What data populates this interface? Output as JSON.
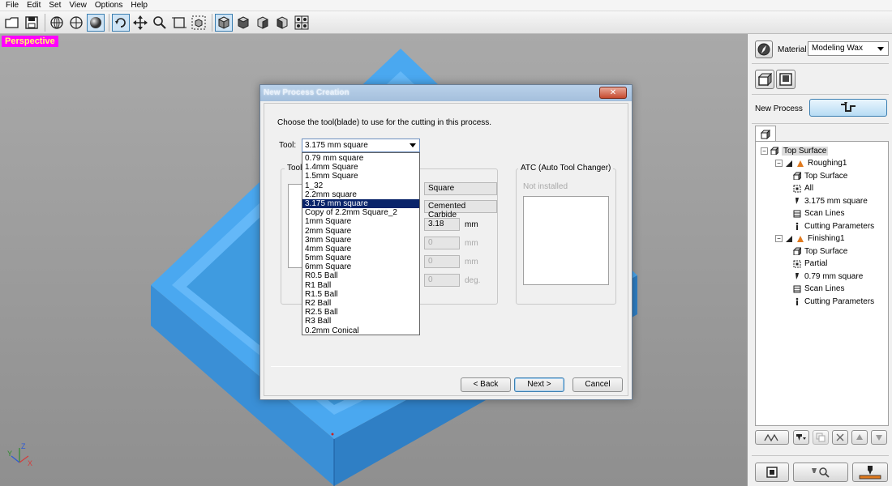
{
  "menu": [
    "File",
    "Edit",
    "Set",
    "View",
    "Options",
    "Help"
  ],
  "viewport": {
    "label": "Perspective",
    "axis_labels": {
      "x": "X",
      "y": "Y",
      "z": "Z"
    }
  },
  "dialog": {
    "title": "New Process Creation",
    "close_label": "✕",
    "prompt": "Choose the tool(blade) to use for the cutting in this process.",
    "tool_label": "Tool:",
    "tool_selected": "3.175 mm square",
    "tool_options": [
      "0.79 mm square",
      "1.4mm Square",
      "1.5mm Square",
      "1_32",
      "2.2mm square",
      "3.175 mm square",
      "Copy of 2.2mm Square_2",
      "1mm Square",
      "2mm Square",
      "3mm Square",
      "4mm Square",
      "5mm Square",
      "6mm Square",
      "R0.5 Ball",
      "R1 Ball",
      "R1.5 Ball",
      "R2 Ball",
      "R2.5 Ball",
      "R3 Ball",
      "0.2mm Conical"
    ],
    "tool_group_title": "Tool",
    "fields": {
      "shape": "Square",
      "material": "Cemented Carbide",
      "diameter": "3.18",
      "diameter_unit": "mm",
      "f2": "0",
      "f2_unit": "mm",
      "f3": "0",
      "f3_unit": "mm",
      "f4": "0",
      "f4_unit": "deg."
    },
    "atc_title": "ATC (Auto Tool Changer)",
    "atc_status": "Not installed",
    "back_label": "< Back",
    "next_label": "Next >",
    "cancel_label": "Cancel"
  },
  "panel": {
    "material_label": "Material",
    "material_value": "Modeling Wax",
    "new_process_label": "New Process",
    "tree": [
      {
        "label": "Top Surface",
        "level": 0,
        "icon": "surface-icon",
        "toggle": "−",
        "selected": true
      },
      {
        "label": "Roughing1",
        "level": 1,
        "icon": "roughing-icon",
        "toggle": "−"
      },
      {
        "label": "Top Surface",
        "level": 2,
        "icon": "surface-icon"
      },
      {
        "label": "All",
        "level": 2,
        "icon": "area-icon"
      },
      {
        "label": "3.175 mm square",
        "level": 2,
        "icon": "tool-icon"
      },
      {
        "label": "Scan Lines",
        "level": 2,
        "icon": "scanlines-icon"
      },
      {
        "label": "Cutting Parameters",
        "level": 2,
        "icon": "parameters-icon"
      },
      {
        "label": "Finishing1",
        "level": 1,
        "icon": "finishing-icon",
        "toggle": "−"
      },
      {
        "label": "Top Surface",
        "level": 2,
        "icon": "surface-icon"
      },
      {
        "label": "Partial",
        "level": 2,
        "icon": "area-icon"
      },
      {
        "label": "0.79 mm square",
        "level": 2,
        "icon": "tool-icon"
      },
      {
        "label": "Scan Lines",
        "level": 2,
        "icon": "scanlines-icon"
      },
      {
        "label": "Cutting Parameters",
        "level": 2,
        "icon": "parameters-icon"
      }
    ]
  },
  "colors": {
    "model_blue": "#4aa8f0",
    "perspective_bg": "#ff00ff",
    "selection": "#0a246a"
  }
}
